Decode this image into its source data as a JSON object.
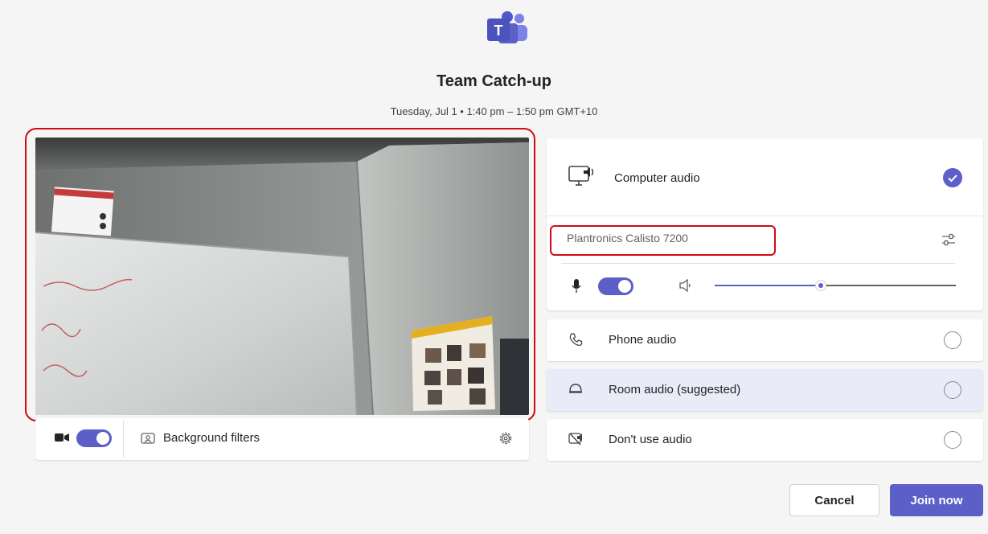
{
  "meeting": {
    "title": "Team Catch-up",
    "time": "Tuesday, Jul 1 • 1:40 pm – 1:50 pm GMT+10"
  },
  "video": {
    "camera_on": true,
    "background_filters_label": "Background filters"
  },
  "audio": {
    "computer_audio_label": "Computer audio",
    "computer_audio_selected": true,
    "device_name": "Plantronics Calisto 7200",
    "mic_on": true,
    "volume_level": 0.44,
    "options": [
      {
        "label": "Phone audio",
        "icon": "phone-icon",
        "selected": false
      },
      {
        "label": "Room audio (suggested)",
        "icon": "room-audio-icon",
        "selected": false
      },
      {
        "label": "Don't use audio",
        "icon": "speaker-off-icon",
        "selected": false
      }
    ]
  },
  "actions": {
    "cancel_label": "Cancel",
    "join_label": "Join now"
  },
  "colors": {
    "accent": "#5b5fc7",
    "highlight_outline": "#d10a11",
    "suggested_bg": "#e9ebf8"
  }
}
